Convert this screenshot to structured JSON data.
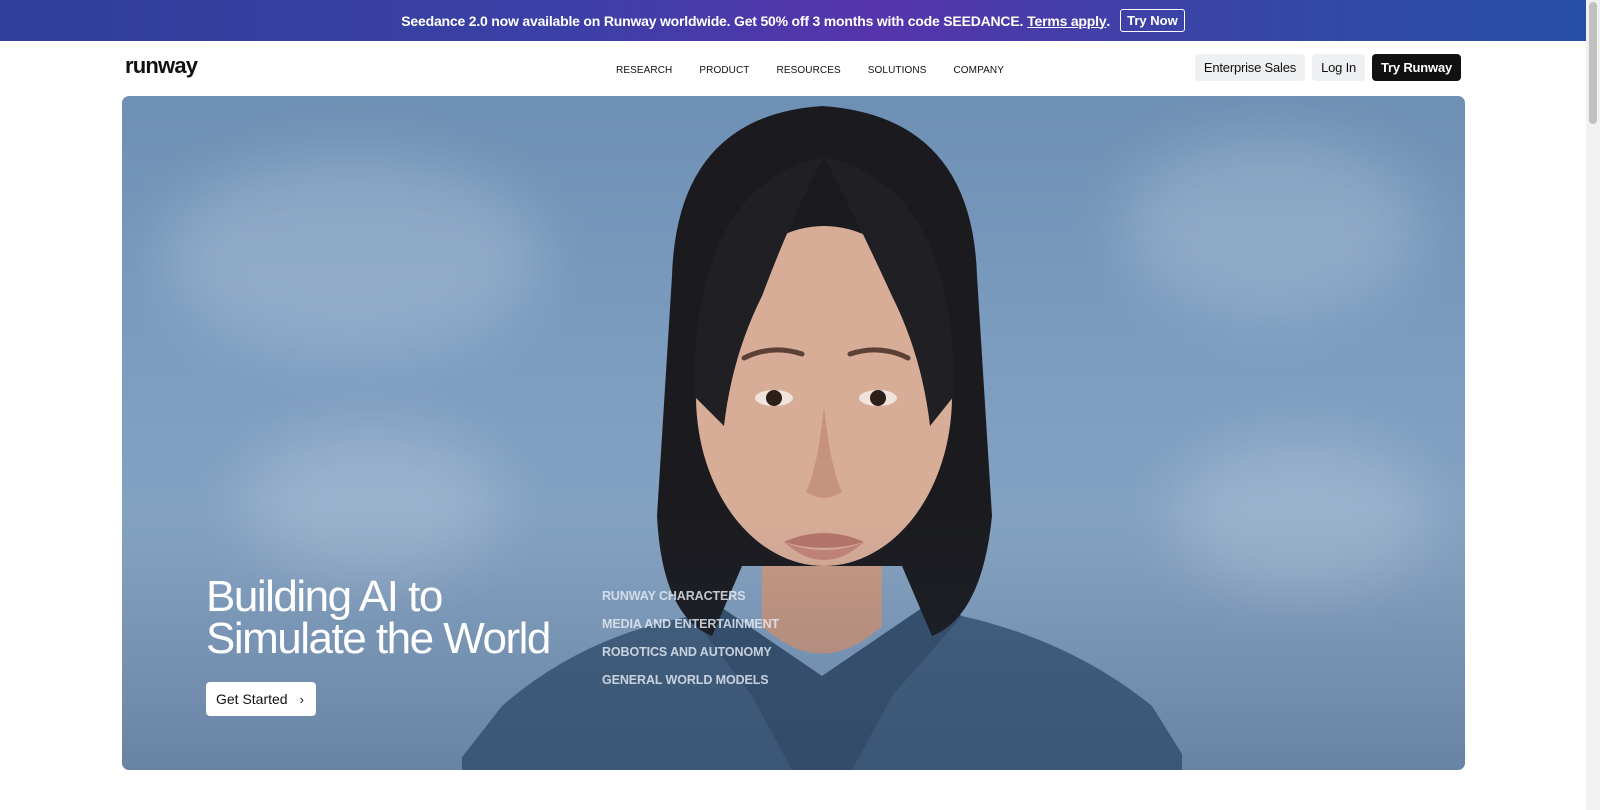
{
  "banner": {
    "message": "Seedance 2.0 now available on Runway worldwide. Get 50% off 3 months with code SEEDANCE.",
    "terms_label": "Terms apply",
    "terms_suffix": ".",
    "cta_label": "Try Now"
  },
  "header": {
    "logo": "runway",
    "nav": [
      "RESEARCH",
      "PRODUCT",
      "RESOURCES",
      "SOLUTIONS",
      "COMPANY"
    ],
    "enterprise_label": "Enterprise Sales",
    "login_label": "Log In",
    "try_label": "Try Runway"
  },
  "hero": {
    "title_line1": "Building AI to",
    "title_line2": "Simulate the World",
    "cta_label": "Get Started",
    "cta_icon": "chevron-right-icon",
    "links": [
      "RUNWAY CHARACTERS",
      "MEDIA AND ENTERTAINMENT",
      "ROBOTICS AND AUTONOMY",
      "GENERAL WORLD MODELS"
    ]
  },
  "colors": {
    "banner_start": "#2f3f9a",
    "banner_mid": "#5634ac",
    "dark_button": "#111111",
    "light_button": "#eef0f2",
    "sky": "#7d9dc0"
  }
}
